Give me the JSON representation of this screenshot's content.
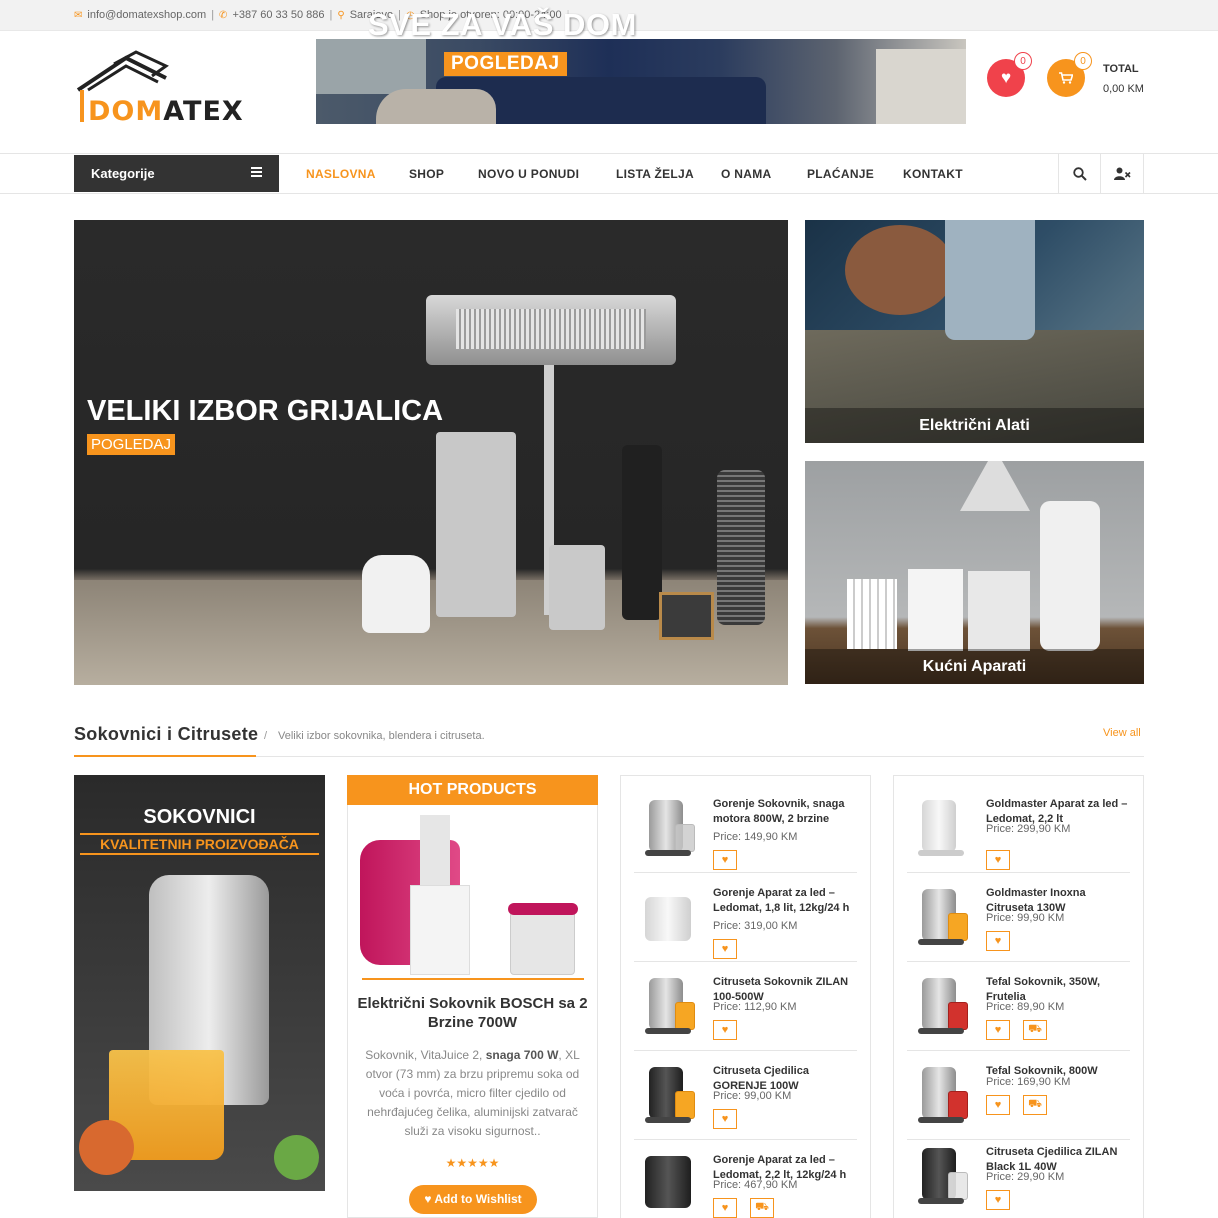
{
  "topbar": {
    "email": "info@domatexshop.com",
    "phone": "+387 60 33 50 886",
    "city": "Sarajevo",
    "hours": "Shop je otvoren: 00:00-24:00"
  },
  "logo": {
    "part1": "DOM",
    "part2": "ATEX"
  },
  "banner": {
    "title": "SVE ZA VAŠ DOM",
    "button": "POGLEDAJ"
  },
  "header": {
    "wishlist_count": "0",
    "cart_count": "0",
    "total_label": "TOTAL",
    "total_value": "0,00 KM"
  },
  "nav": {
    "categories_label": "Kategorije",
    "items": [
      "NASLOVNA",
      "SHOP",
      "NOVO U PONUDI",
      "LISTA ŽELJA",
      "O NAMA",
      "PLAĆANJE",
      "KONTAKT"
    ]
  },
  "hero": {
    "title": "VELIKI IZBOR GRIJALICA",
    "button": "POGLEDAJ"
  },
  "side_banners": [
    "Električni Alati",
    "Kućni Aparati"
  ],
  "section": {
    "title": "Sokovnici i Citrusete",
    "separator": "/",
    "subtitle": "Veliki izbor sokovnika, blendera i citruseta.",
    "view_all": "View all"
  },
  "promo": {
    "title": "SOKOVNICI",
    "subtitle": "KVALITETNIH PROIZVOĐAČA"
  },
  "hot": {
    "header": "HOT PRODUCTS",
    "name": "Električni Sokovnik BOSCH sa 2 Brzine 700W",
    "desc_before": "Sokovnik, VitaJuice 2, ",
    "desc_bold": "snaga 700 W",
    "desc_after": ", XL otvor (73 mm) za brzu pripremu soka od voća i povrća, micro filter cjedilo od nehrđajućeg čelika, aluminijski zatvarač služi za visoku sigurnost..",
    "stars": "★★★★★",
    "rating": 5,
    "wishlist_button": "Add to Wishlist"
  },
  "products_col1": [
    {
      "name": "Gorenje Sokovnik, snaga motora 800W, 2 brzine",
      "price": "Price: 149,90 KM",
      "cart": false
    },
    {
      "name": "Gorenje Aparat za led – Ledomat, 1,8 lit, 12kg/24 h",
      "price": "Price: 319,00 KM",
      "cart": false
    },
    {
      "name": "Citruseta Sokovnik ZILAN 100-500W",
      "price": "Price: 112,90 KM",
      "cart": false
    },
    {
      "name": "Citruseta Cjedilica GORENJE 100W",
      "price": "Price: 99,00 KM",
      "cart": false
    },
    {
      "name": "Gorenje Aparat za led – Ledomat, 2,2 lt, 12kg/24 h",
      "price": "Price: 467,90 KM",
      "cart": true
    }
  ],
  "products_col2": [
    {
      "name": "Goldmaster Aparat za led – Ledomat, 2,2 lt",
      "price": "Price: 299,90 KM",
      "cart": false
    },
    {
      "name": "Goldmaster Inoxna Citruseta 130W",
      "price": "Price: 99,90 KM",
      "cart": false
    },
    {
      "name": "Tefal Sokovnik, 350W, Frutelia",
      "price": "Price: 89,90 KM",
      "cart": true
    },
    {
      "name": "Tefal Sokovnik, 800W",
      "price": "Price: 169,90 KM",
      "cart": true
    },
    {
      "name": "Citruseta Cjedilica ZILAN Black 1L 40W",
      "price": "Price: 29,90 KM",
      "cart": false
    }
  ],
  "colors": {
    "accent": "#f7941d",
    "wishlist": "#f0424b",
    "dark": "#333333"
  }
}
